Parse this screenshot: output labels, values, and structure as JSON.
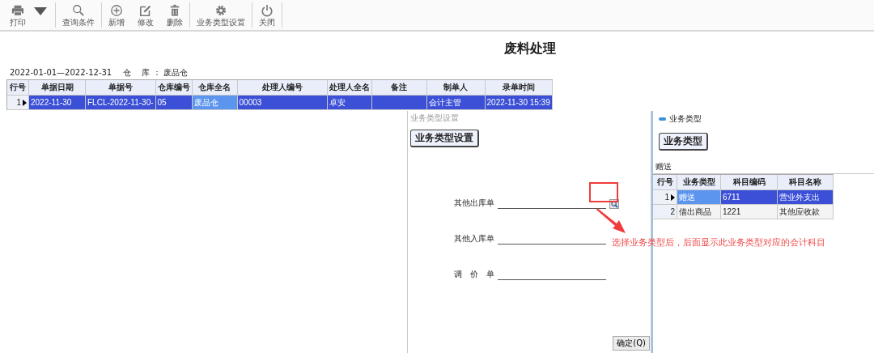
{
  "toolbar": {
    "items": [
      {
        "label": "打印",
        "kind": "printer",
        "dropdown": true
      },
      {
        "label": "查询条件",
        "kind": "search",
        "dropdown": false
      },
      {
        "label": "新增",
        "kind": "add",
        "dropdown": false
      },
      {
        "label": "修改",
        "kind": "edit",
        "dropdown": false
      },
      {
        "label": "删除",
        "kind": "delete",
        "dropdown": false
      },
      {
        "label": "业务类型设置",
        "kind": "settings",
        "dropdown": false
      },
      {
        "label": "关闭",
        "kind": "power",
        "dropdown": false
      }
    ]
  },
  "title": "废料处理",
  "filter": {
    "date_range": "2022-01-01—2022-12-31",
    "warehouse": "仓　 库 ： 废品仓"
  },
  "table": {
    "columns": [
      "行号",
      "单据日期",
      "单据号",
      "仓库编号",
      "仓库全名",
      "处理人编号",
      "处理人全名",
      "备注",
      "制单人",
      "录单时间"
    ],
    "rows": [
      {
        "selected": true,
        "cells": [
          {
            "text": "1"
          },
          {
            "text": "2022-11-30",
            "focused": false
          },
          {
            "text": "FLCL-2022-11-30-",
            "focused": false
          },
          {
            "text": "05",
            "focused": false
          },
          {
            "text": "废品仓",
            "focused": true
          },
          {
            "text": "00003",
            "focused": false
          },
          {
            "text": "卓安",
            "focused": false
          },
          {
            "text": "",
            "focused": false
          },
          {
            "text": "会计主管",
            "focused": false
          },
          {
            "text": "2022-11-30 15:39",
            "focused": false
          }
        ]
      }
    ]
  },
  "dialog": {
    "window_title": "业务类型设置",
    "heading": "业务类型设置",
    "fields": [
      {
        "label": "其他出库单",
        "lookup": true
      },
      {
        "label": "其他入库单",
        "lookup": false
      },
      {
        "label": "调　价　单",
        "lookup": false
      }
    ],
    "confirm_button": "确定(Q)"
  },
  "type_panel": {
    "window_title": "业务类型",
    "heading": "业务类型",
    "current_type": "赠送",
    "table": {
      "columns": [
        "行号",
        "业务类型",
        "科目编码",
        "科目名称"
      ],
      "rows": [
        {
          "selected": true,
          "cells": [
            {
              "text": "1"
            },
            {
              "text": "赠送",
              "focused": true
            },
            {
              "text": "6711",
              "focused": false
            },
            {
              "text": "营业外支出",
              "focused": false
            }
          ]
        },
        {
          "selected": false,
          "cells": [
            {
              "text": "2"
            },
            {
              "text": "借出商品",
              "focused": false
            },
            {
              "text": "1221",
              "focused": false
            },
            {
              "text": "其他应收款",
              "focused": false
            }
          ]
        }
      ]
    }
  },
  "annotation": {
    "text": "选择业务类型后，后面显示此业务类型对应的会计科目"
  }
}
